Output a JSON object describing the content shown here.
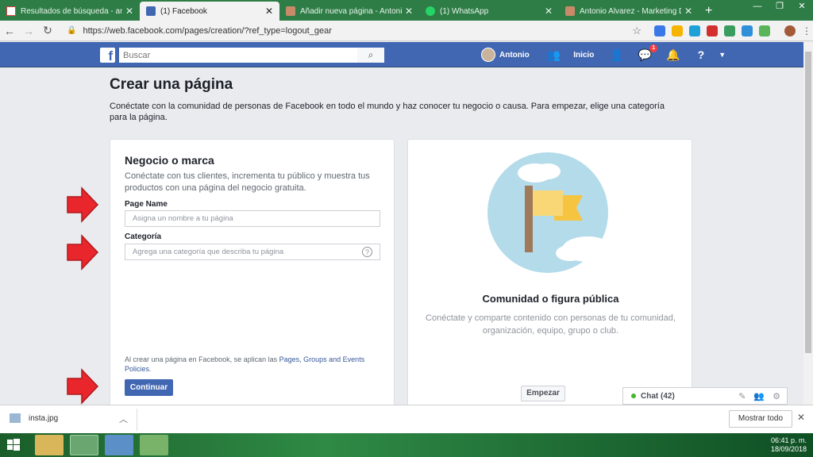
{
  "browser": {
    "tabs": [
      {
        "label": "Resultados de búsqueda - anto",
        "icon": "gmail-icon",
        "active": false
      },
      {
        "label": "(1) Facebook",
        "icon": "facebook-icon",
        "active": true
      },
      {
        "label": "Añadir nueva página - Antonio",
        "icon": "wordpress-icon",
        "active": false
      },
      {
        "label": "(1) WhatsApp",
        "icon": "whatsapp-icon",
        "active": false
      },
      {
        "label": "Antonio Alvarez - Marketing Dig",
        "icon": "wordpress-icon",
        "active": false
      }
    ],
    "url": "https://web.facebook.com/pages/creation/?ref_type=logout_gear"
  },
  "fbbar": {
    "search_placeholder": "Buscar",
    "user_name": "Antonio",
    "home_label": "Inicio",
    "messages_badge": "1"
  },
  "page": {
    "title": "Crear una página",
    "intro": "Conéctate con la comunidad de personas de Facebook en todo el mundo y haz conocer tu negocio o causa. Para empezar, elige una categoría para la página."
  },
  "business_card": {
    "title": "Negocio o marca",
    "description": "Conéctate con tus clientes, incrementa tu público y muestra tus productos con una página del negocio gratuita.",
    "page_name_label": "Page Name",
    "page_name_placeholder": "Asigna un nombre a tu página",
    "category_label": "Categoría",
    "category_placeholder": "Agrega una categoría que describa tu página",
    "policy_prefix": "Al crear una página en Facebook, se aplican las ",
    "policy_link": "Pages, Groups and Events Policies",
    "policy_suffix": ".",
    "continue_label": "Continuar"
  },
  "community_card": {
    "title": "Comunidad o figura pública",
    "description": "Conéctate y comparte contenido con personas de tu comunidad, organización, equipo, grupo o club.",
    "start_label": "Empezar"
  },
  "chat": {
    "label": "Chat (42)"
  },
  "downloads": {
    "file_name": "insta.jpg",
    "show_all_label": "Mostrar todo"
  },
  "taskbar": {
    "time": "06:41 p. m.",
    "date": "18/09/2018"
  },
  "colors": {
    "fb_blue": "#4267b2",
    "arrow_red": "#e8262b",
    "illustration_sky": "#b3dbea",
    "flag_yellow": "#f9d776"
  }
}
